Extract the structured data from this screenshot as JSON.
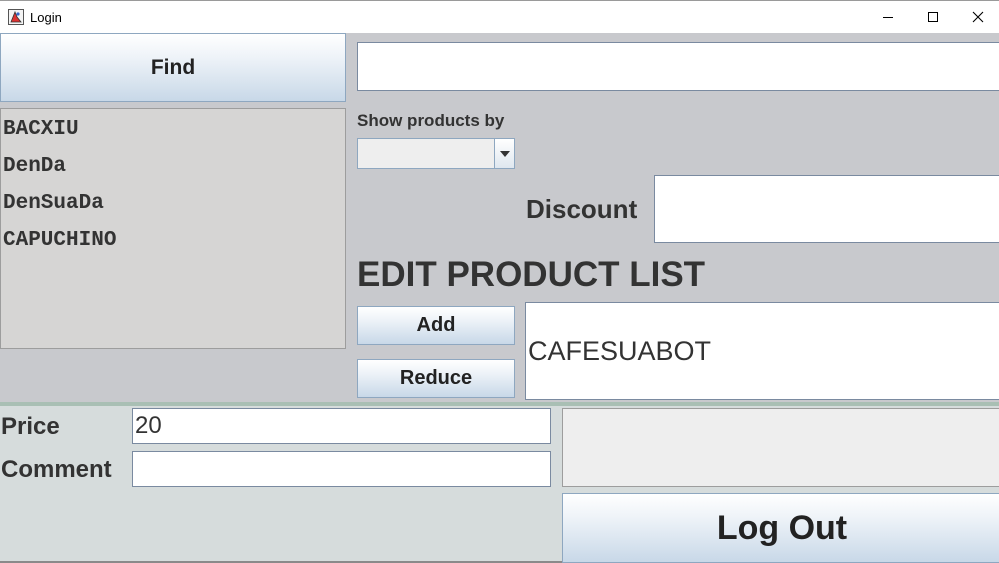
{
  "window": {
    "title": "Login"
  },
  "search": {
    "button_label": "Find",
    "value": ""
  },
  "products": [
    "BACXIU",
    "DenDa",
    "DenSuaDa",
    "CAPUCHINO"
  ],
  "filter": {
    "label": "Show products by",
    "selected": ""
  },
  "discount": {
    "label": "Discount",
    "value": ""
  },
  "edit": {
    "title": "EDIT PRODUCT LIST",
    "add_label": "Add",
    "reduce_label": "Reduce",
    "product_name": "CAFESUABOT"
  },
  "details": {
    "price_label": "Price",
    "price_value": "20",
    "comment_label": "Comment",
    "comment_value": ""
  },
  "logout_label": "Log Out",
  "colors": {
    "button_gradient_bottom": "#c8d8e8",
    "panel_top": "#c8c9cd",
    "panel_bottom": "#d6dcdc"
  }
}
